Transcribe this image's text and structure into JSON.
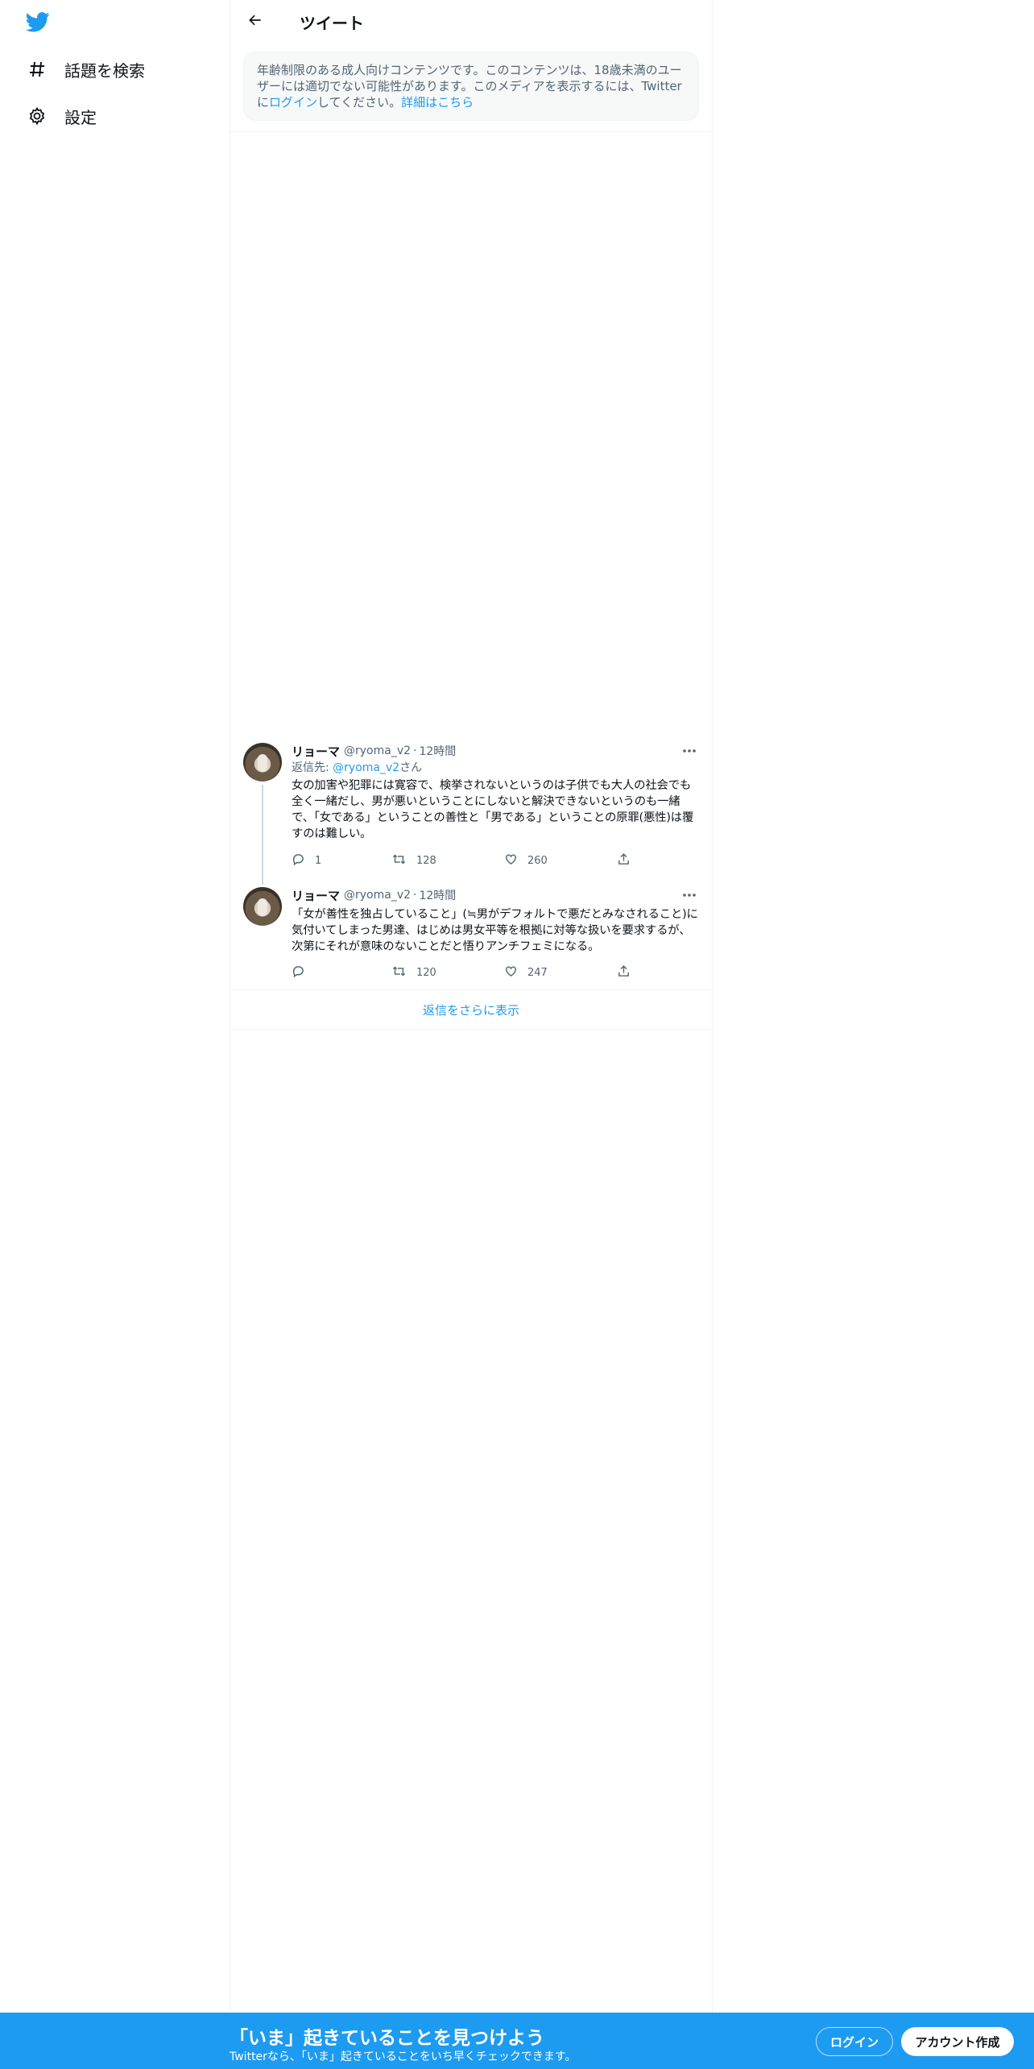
{
  "sidebar": {
    "logo_icon": "twitter-bird-icon",
    "items": [
      {
        "icon": "hashtag-icon",
        "label": "話題を検索"
      },
      {
        "icon": "gear-icon",
        "label": "設定"
      }
    ]
  },
  "header": {
    "back_icon": "arrow-left-icon",
    "title": "ツイート"
  },
  "notice": {
    "text_before": "年齢制限のある成人向けコンテンツです。このコンテンツは、18歳未満のユーザーには適切でない可能性があります。このメディアを表示するには、Twitterに",
    "login_link": "ログイン",
    "text_after": "してください。",
    "details_link": "詳細はこちら"
  },
  "tweets": [
    {
      "name": "リョーマ",
      "handle": "@ryoma_v2",
      "separator": "·",
      "time": "12時間",
      "reply_prefix": "返信先: ",
      "reply_handle": "@ryoma_v2",
      "reply_suffix": "さん",
      "text": "女の加害や犯罪には寛容で、検挙されないというのは子供でも大人の社会でも全く一緒だし、男が悪いということにしないと解決できないというのも一緒で、「女である」ということの善性と「男である」ということの原罪(悪性)は覆すのは難しい。",
      "replies": "1",
      "retweets": "128",
      "likes": "260"
    },
    {
      "name": "リョーマ",
      "handle": "@ryoma_v2",
      "separator": "·",
      "time": "12時間",
      "text": "「女が善性を独占していること」(≒男がデフォルトで悪だとみなされること)に気付いてしまった男達、はじめは男女平等を根拠に対等な扱いを要求するが、次第にそれが意味のないことだと悟りアンチフェミになる。",
      "replies": "",
      "retweets": "120",
      "likes": "247"
    }
  ],
  "show_more": "返信をさらに表示",
  "bottom_bar": {
    "title": "「いま」起きていることを見つけよう",
    "subtitle": "Twitterなら、「いま」起きていることをいち早くチェックできます。",
    "login_button": "ログイン",
    "signup_button": "アカウント作成"
  },
  "colors": {
    "accent": "#1d9bf0",
    "text_primary": "#0f1419",
    "text_secondary": "#536471",
    "border": "#eff3f4"
  }
}
